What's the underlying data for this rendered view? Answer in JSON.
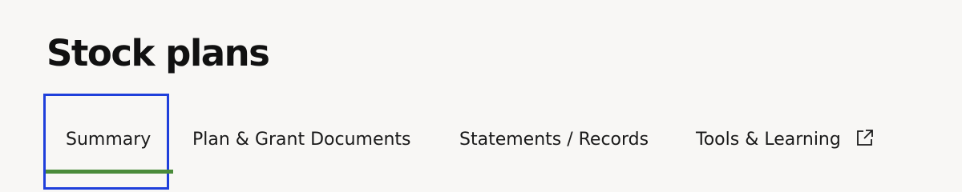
{
  "page": {
    "title": "Stock plans"
  },
  "tabs": [
    {
      "label": "Summary",
      "active": true
    },
    {
      "label": "Plan & Grant Documents",
      "active": false
    },
    {
      "label": "Statements / Records",
      "active": false
    },
    {
      "label": "Tools & Learning",
      "active": false,
      "icon": "external-link-icon"
    }
  ],
  "colors": {
    "background": "#f8f7f5",
    "text": "#1a1a1a",
    "active_tab_underline": "#4a8b3a",
    "focus_ring": "#1f3fdb"
  }
}
